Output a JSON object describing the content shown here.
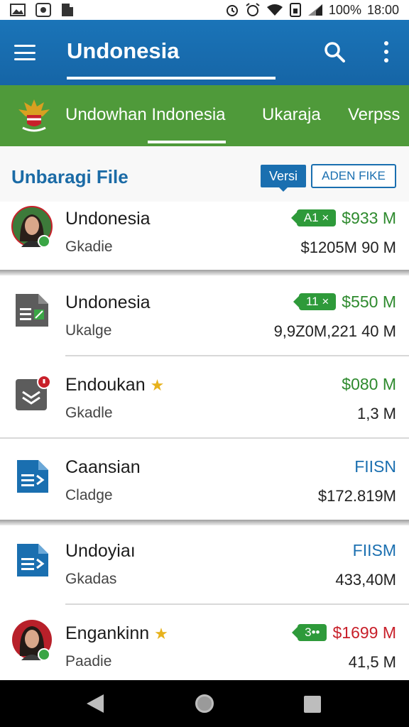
{
  "status_bar": {
    "battery": "100%",
    "time": "18:00",
    "icons": [
      "image-icon",
      "app-icon",
      "file-icon",
      "alarm-icon",
      "alarm-clock-icon",
      "wifi-icon",
      "sim-icon",
      "signal-icon"
    ]
  },
  "app_bar": {
    "title": "Undonesia",
    "icons": [
      "menu-icon",
      "search-icon",
      "more-vert-icon"
    ]
  },
  "tabs": [
    {
      "label": "Undowhan Indonesia",
      "active": true
    },
    {
      "label": "Ukaraja",
      "active": false
    },
    {
      "label": "Verpss",
      "active": false
    }
  ],
  "section": {
    "title": "Unbaragi File",
    "versi_label": "Versi",
    "open_label": "ADEN FIKE"
  },
  "items": [
    {
      "title": "Undonesia",
      "subtitle": "Gkadie",
      "badge": "A1 ×",
      "value": "$933 M",
      "value_color": "green",
      "detail": "$1205M 90 M",
      "icon": "avatar-woman-icon"
    },
    {
      "title": "Undonesia",
      "subtitle": "Ukalge",
      "badge": "11 ×",
      "value": "$550 M",
      "value_color": "green",
      "detail": "9,9Z0M,221 40 M",
      "icon": "spreadsheet-file-icon"
    },
    {
      "title": "Endoukan",
      "subtitle": "Gkadle",
      "badge": "",
      "value": "$080 M",
      "value_color": "green",
      "detail": "1,3 M",
      "icon": "layers-file-icon",
      "starred": true
    },
    {
      "title": "Caansian",
      "subtitle": "Cladge",
      "badge": "",
      "value": "FIISN",
      "value_color": "blue",
      "detail": "$172.819M",
      "icon": "document-file-icon"
    },
    {
      "title": "Undoyiaı",
      "subtitle": "Gkadas",
      "badge": "",
      "value": "FIISM",
      "value_color": "blue",
      "detail": "433,40M",
      "icon": "document-file-icon"
    },
    {
      "title": "Engankinn",
      "subtitle": "Paadie",
      "badge": "3••",
      "value": "$1699 M",
      "value_color": "red",
      "detail": "41,5 M",
      "icon": "avatar-woman-icon",
      "starred": true
    }
  ],
  "colors": {
    "app_bar": "#1a74b8",
    "tab_bar": "#4f9a3a",
    "accent_blue": "#1a6fb0",
    "green_value": "#2e8a2e",
    "red_value": "#c8202a"
  }
}
